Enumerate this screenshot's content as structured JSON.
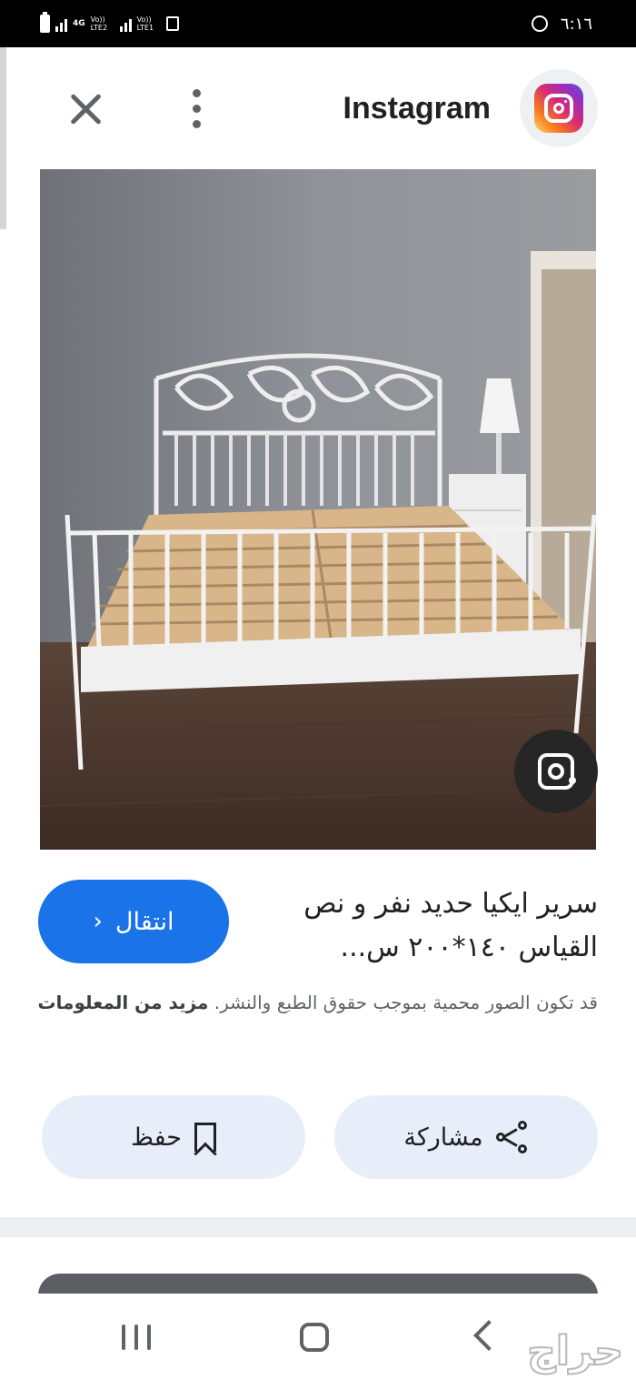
{
  "status_bar": {
    "time": "٦:١٦",
    "network_1": "4G",
    "network_1_sub": "Vo)) LTE2",
    "network_2_sub": "Vo)) LTE1"
  },
  "header": {
    "app_title": "Instagram"
  },
  "result": {
    "title": "سرير ايكيا حديد نفر و نص القياس ١٤٠*٢٠٠ س...",
    "visit_label": "انتقال",
    "copyright": "قد تكون الصور محمية بموجب حقوق الطبع والنشر.",
    "more_info": "مزيد من المعلومات"
  },
  "actions": {
    "share_label": "مشاركة",
    "save_label": "حفظ"
  },
  "watermark": "حراج",
  "icons": {
    "close": "close-icon",
    "more": "more-vert-icon",
    "app": "instagram-icon",
    "lens": "google-lens-icon",
    "share": "share-icon",
    "save": "bookmark-icon"
  },
  "colors": {
    "accent": "#1a73e8",
    "chip_bg": "#e8eef9"
  }
}
